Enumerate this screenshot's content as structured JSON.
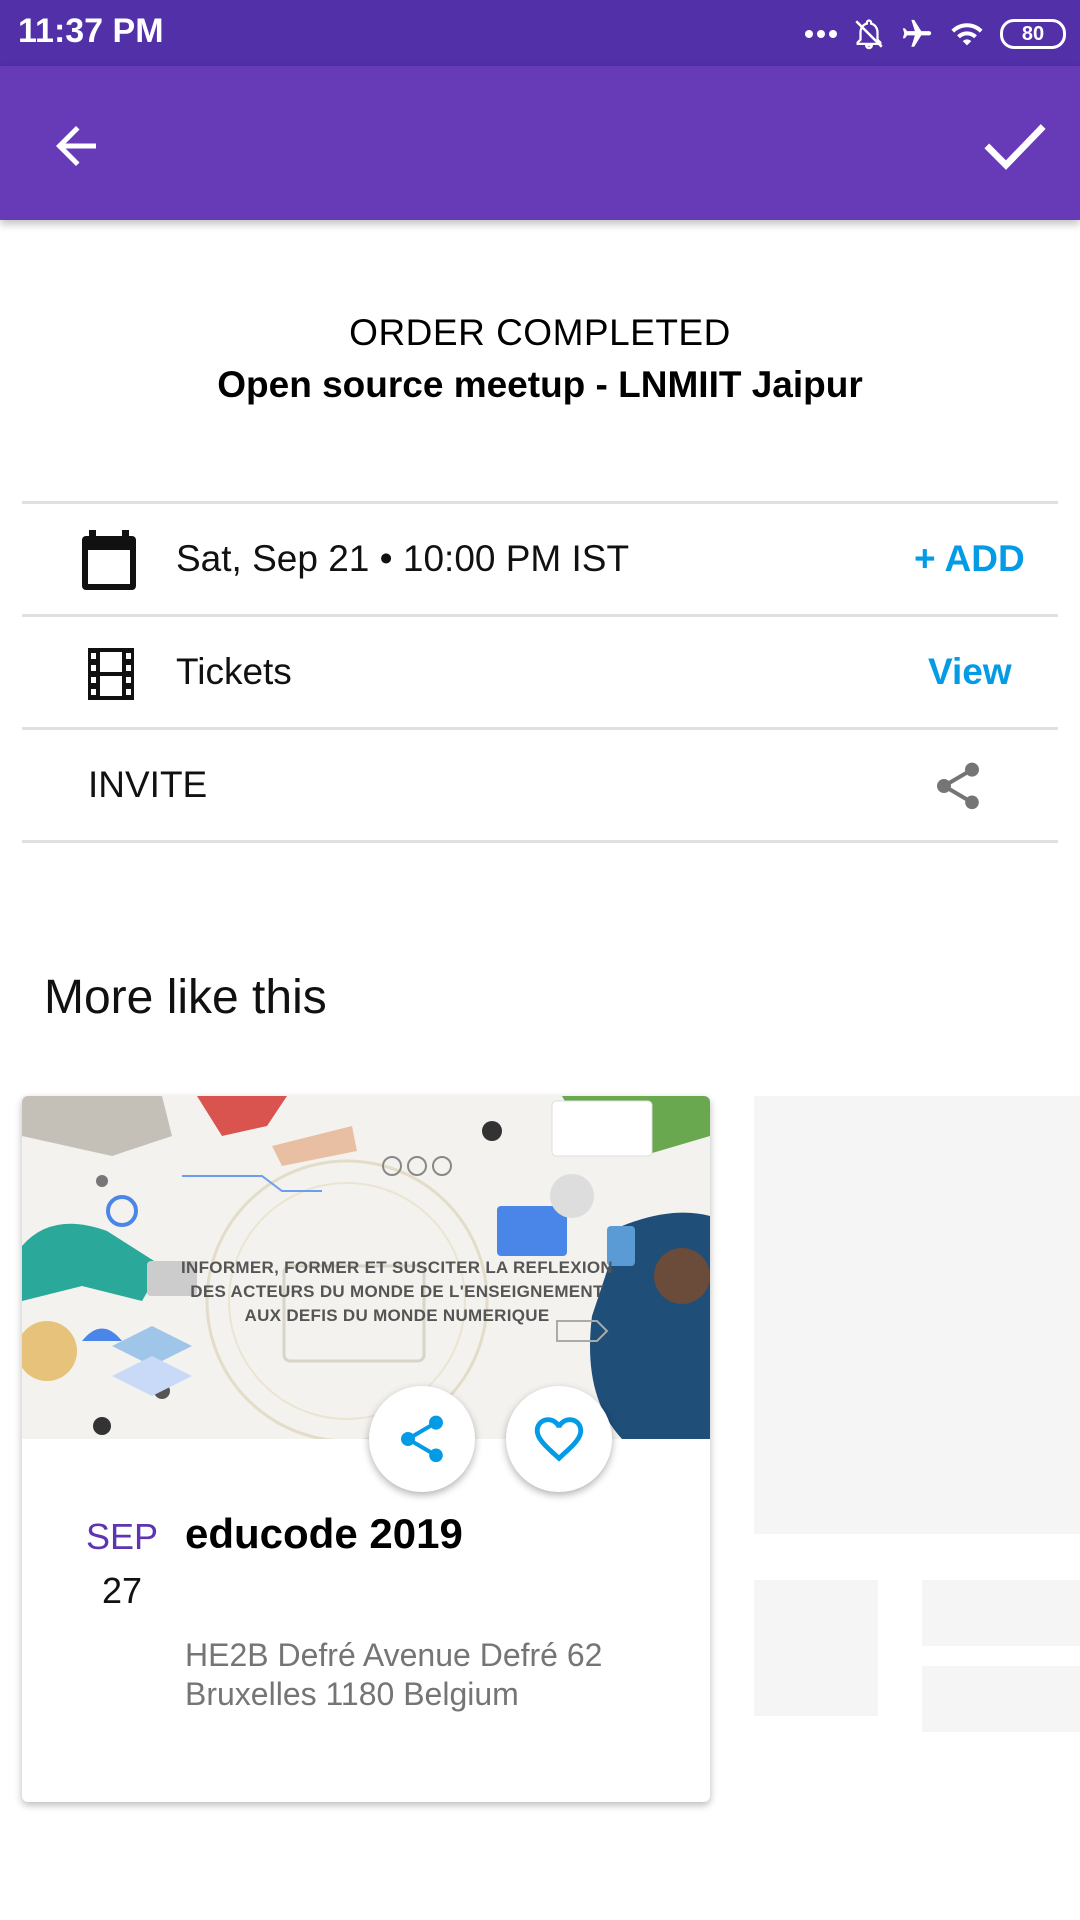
{
  "status_bar": {
    "time": "11:37 PM",
    "battery": "80"
  },
  "app_bar": {
    "back_icon": "arrow-back-icon",
    "done_icon": "check-icon"
  },
  "order": {
    "status": "ORDER COMPLETED",
    "event_name": "Open source meetup - LNMIIT Jaipur"
  },
  "details": {
    "date_text": "Sat, Sep 21 • 10:00 PM IST",
    "date_action": "+ ADD",
    "tickets_label": "Tickets",
    "tickets_action": "View",
    "invite_label": "INVITE"
  },
  "more": {
    "title": "More like this",
    "card": {
      "image_text": [
        "INFORMER, FORMER ET SUSCITER LA REFLEXION",
        "DES ACTEURS DU MONDE DE L'ENSEIGNEMENT",
        "AUX DEFIS DU MONDE NUMERIQUE"
      ],
      "month": "SEP",
      "day": "27",
      "title": "educode 2019",
      "address_line1": "HE2B Defré Avenue Defré 62",
      "address_line2": "Bruxelles  1180 Belgium"
    }
  },
  "colors": {
    "status_bar": "#5230a8",
    "app_bar": "#673ab7",
    "link": "#039be5",
    "month": "#5e35b1",
    "placeholder": "#f5f5f5"
  }
}
